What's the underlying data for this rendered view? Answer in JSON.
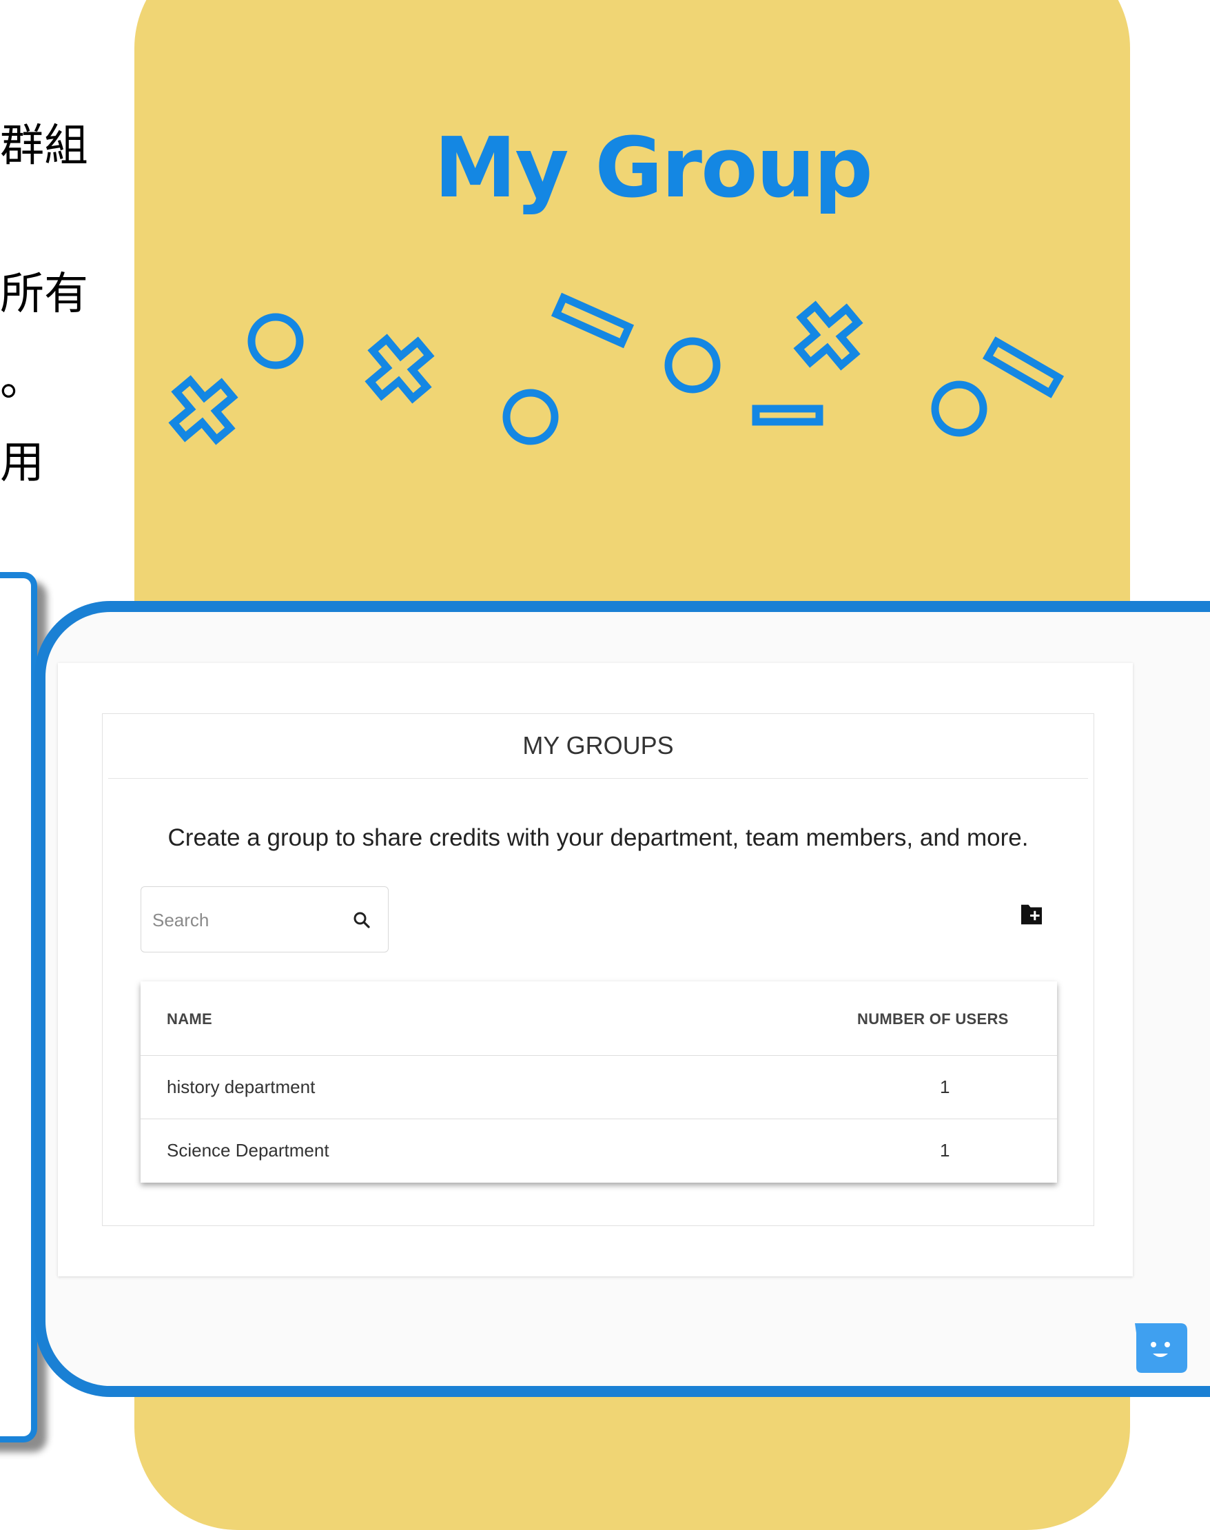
{
  "side_text": [
    "群組",
    "所有",
    "。",
    "用"
  ],
  "hero": {
    "title": "My Group"
  },
  "panel": {
    "title": "MY GROUPS",
    "subtitle": "Create a group to share credits with your department, team members, and more.",
    "search": {
      "placeholder": "Search",
      "value": ""
    },
    "table": {
      "columns": [
        "NAME",
        "NUMBER OF USERS"
      ],
      "rows": [
        {
          "name": "history department",
          "users": "1"
        },
        {
          "name": "Science Department",
          "users": "1"
        }
      ]
    }
  },
  "icons": {
    "search": "search-icon",
    "add_group": "add-folder-icon",
    "chat": "chat-bot-icon"
  },
  "colors": {
    "accent": "#1487e3",
    "panel_background": "#f0d574",
    "frame_border": "#1a80d4",
    "chat_widget": "#3fa0f0"
  }
}
